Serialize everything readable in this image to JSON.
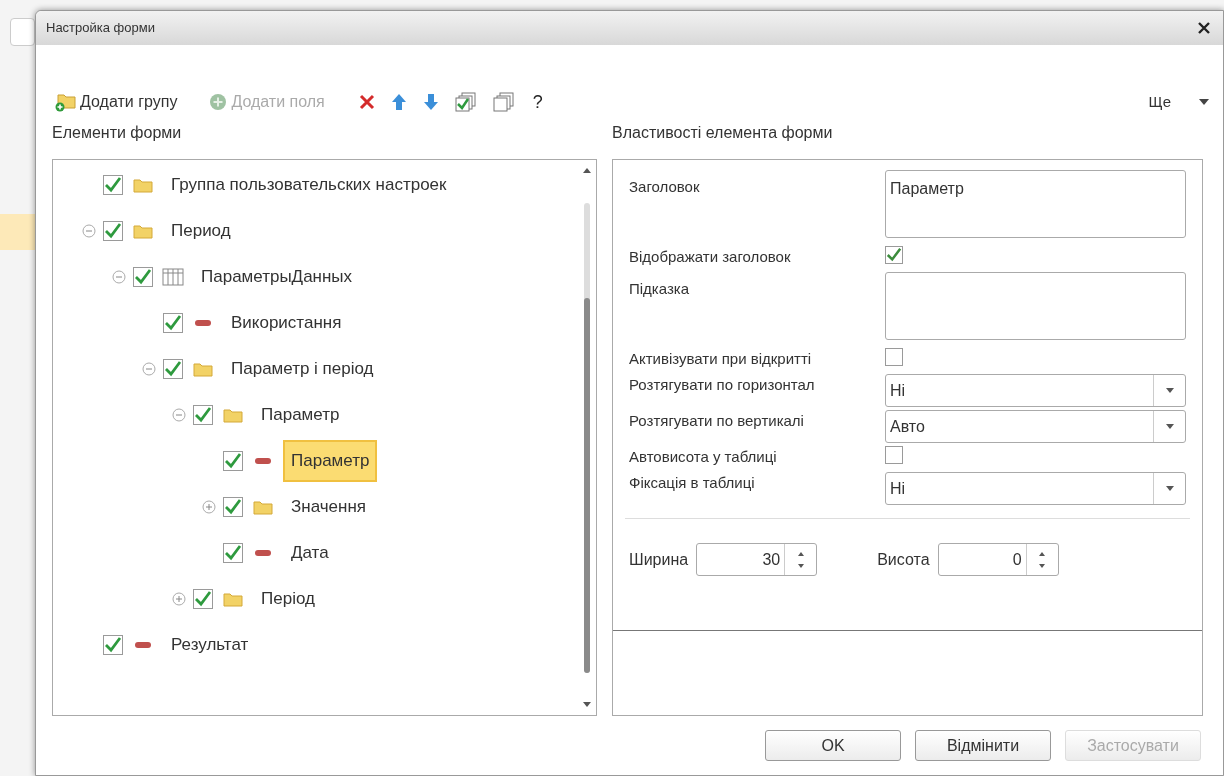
{
  "window": {
    "title": "Настройка форми"
  },
  "toolbar": {
    "buttons": [
      {
        "kind": "add-group",
        "label": "Додати групу",
        "disabled": false
      },
      {
        "kind": "add-fields",
        "label": "Додати поля",
        "disabled": true
      },
      {
        "kind": "delete"
      },
      {
        "kind": "up"
      },
      {
        "kind": "down"
      },
      {
        "kind": "check-all"
      },
      {
        "kind": "uncheck-all"
      },
      {
        "kind": "help",
        "label": "?"
      }
    ],
    "more": {
      "label": "Ще"
    }
  },
  "tree": {
    "title": "Елементи форми",
    "items": [
      {
        "label": "Группа пользовательских настроек",
        "kind": "folder",
        "checked": true,
        "selected": false
      },
      {
        "label": "Период",
        "kind": "folder",
        "checked": true,
        "selected": false,
        "expanded": true,
        "children": [
          {
            "label": "ПараметрыДанных",
            "kind": "table",
            "checked": true,
            "selected": false,
            "expanded": true,
            "children": [
              {
                "label": "Використання",
                "kind": "field",
                "checked": true,
                "selected": false
              },
              {
                "label": "Параметр і період",
                "kind": "folder",
                "checked": true,
                "selected": false,
                "expanded": true,
                "children": [
                  {
                    "label": "Параметр",
                    "kind": "folder",
                    "checked": true,
                    "selected": false,
                    "expanded": true,
                    "children": [
                      {
                        "label": "Параметр",
                        "kind": "field",
                        "checked": true,
                        "selected": true
                      },
                      {
                        "label": "Значення",
                        "kind": "folder",
                        "checked": true,
                        "selected": false,
                        "expanded": false
                      },
                      {
                        "label": "Дата",
                        "kind": "field",
                        "checked": true,
                        "selected": false
                      }
                    ]
                  },
                  {
                    "label": "Період",
                    "kind": "folder",
                    "checked": true,
                    "selected": false,
                    "expanded": false
                  }
                ]
              }
            ]
          }
        ]
      },
      {
        "label": "Результат",
        "kind": "field",
        "checked": true,
        "selected": false
      }
    ]
  },
  "properties": {
    "title": "Властивості елемента форми",
    "rows": [
      {
        "kind": "textarea",
        "label": "Заголовок",
        "value": "Параметр"
      },
      {
        "kind": "checkbox",
        "label": "Відображати заголовок",
        "checked": true
      },
      {
        "kind": "textarea",
        "label": "Підказка"
      },
      {
        "kind": "checkbox",
        "label": "Активізувати при відкритті",
        "checked": false
      },
      {
        "kind": "select",
        "label": "Розтягувати по горизонтал",
        "value": "Ні"
      },
      {
        "kind": "select",
        "label": "Розтягувати по вертикалі",
        "value": "Авто"
      },
      {
        "kind": "checkbox",
        "label": "Автовисота у таблиці",
        "checked": false
      },
      {
        "kind": "select",
        "label": "Фіксація в таблиці",
        "value": "Ні"
      }
    ],
    "spinners": [
      {
        "label": "Ширина",
        "value": "30"
      },
      {
        "label": "Висота",
        "value": "0"
      }
    ]
  },
  "buttons": [
    {
      "label": "OK",
      "disabled": false
    },
    {
      "label": "Відмінити",
      "disabled": false
    },
    {
      "label": "Застосувати",
      "disabled": true
    }
  ]
}
